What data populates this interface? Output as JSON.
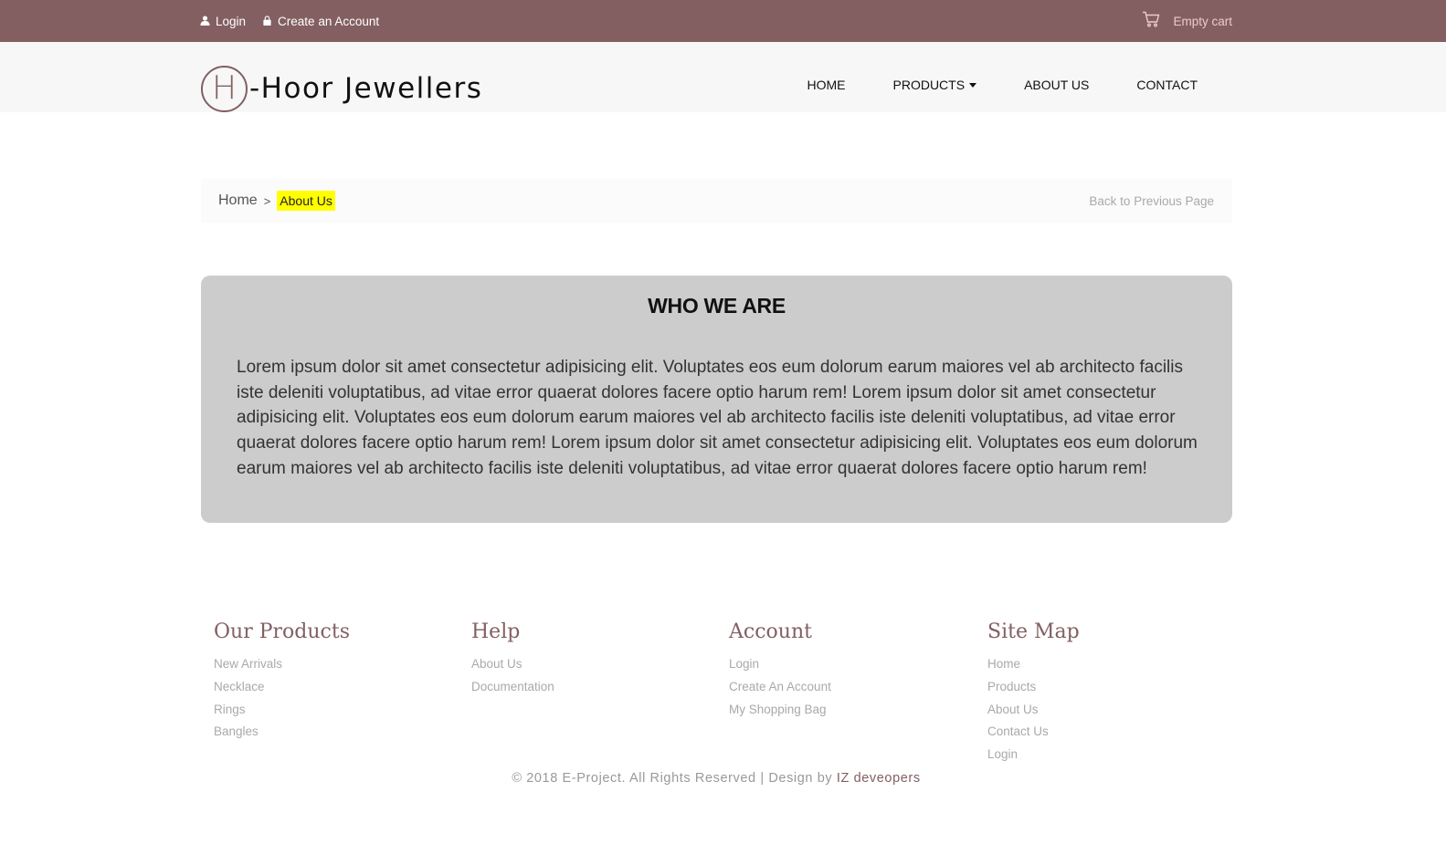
{
  "topbar": {
    "login_label": "Login",
    "create_account_label": "Create an Account",
    "cart_label": "Empty cart"
  },
  "header": {
    "logo_letter": "H",
    "logo_text": "-Hoor Jewellers",
    "nav": {
      "home": "HOME",
      "products": "PRODUCTS",
      "about": "ABOUT US",
      "contact": "CONTACT"
    }
  },
  "breadcrumb": {
    "home": "Home",
    "separator": ">",
    "current": "About Us",
    "back": "Back to Previous Page"
  },
  "about": {
    "title": "WHO WE ARE",
    "body": "Lorem ipsum dolor sit amet consectetur adipisicing elit. Voluptates eos eum dolorum earum maiores vel ab architecto facilis iste deleniti voluptatibus, ad vitae error quaerat dolores facere optio harum rem! Lorem ipsum dolor sit amet consectetur adipisicing elit. Voluptates eos eum dolorum earum maiores vel ab architecto facilis iste deleniti voluptatibus, ad vitae error quaerat dolores facere optio harum rem! Lorem ipsum dolor sit amet consectetur adipisicing elit. Voluptates eos eum dolorum earum maiores vel ab architecto facilis iste deleniti voluptatibus, ad vitae error quaerat dolores facere optio harum rem!"
  },
  "footer": {
    "columns": [
      {
        "title": "Our Products",
        "links": [
          "New Arrivals",
          "Necklace",
          "Rings",
          "Bangles"
        ]
      },
      {
        "title": "Help",
        "links": [
          "About Us",
          "Documentation"
        ]
      },
      {
        "title": "Account",
        "links": [
          "Login",
          "Create An Account",
          "My Shopping Bag"
        ]
      },
      {
        "title": "Site Map",
        "links": [
          "Home",
          "Products",
          "About Us",
          "Contact Us",
          "Login"
        ]
      }
    ],
    "copyright_prefix": "© 2018 E-Project. All Rights Reserved | Design by ",
    "copyright_brand": "IZ deveopers"
  },
  "colors": {
    "brand": "#835f62",
    "highlight": "#ffff00",
    "panel": "#cccccc"
  },
  "icons": {
    "login": "user-icon",
    "create_account": "lock-icon",
    "cart": "cart-icon"
  }
}
